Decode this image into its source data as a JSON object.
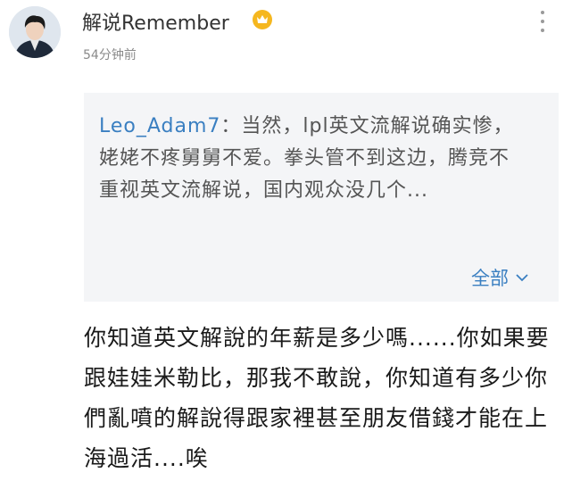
{
  "post": {
    "author": "解说Remember",
    "verified_badge_icon": "crown-icon",
    "time": "54分钟前",
    "more_icon": "more-vertical-icon",
    "avatar_icon": "user-avatar"
  },
  "quote": {
    "author": "Leo_Adam7",
    "separator": "：",
    "text": "当然，lpl英文流解说确实惨，姥姥不疼舅舅不爱。拳头管不到这边，腾竞不重视英文流解说，国内观众没几个...",
    "expand_label": "全部",
    "expand_icon": "chevron-down-icon"
  },
  "reply": {
    "text": "你知道英文解說的年薪是多少嗎......你如果要跟娃娃米勒比，那我不敢說，你知道有多少你們亂噴的解說得跟家裡甚至朋友借錢才能在上海過活....唉"
  },
  "colors": {
    "link_blue": "#3a7fc1",
    "badge_gold": "#f5b71f",
    "quote_background": "#f4f5f7"
  }
}
